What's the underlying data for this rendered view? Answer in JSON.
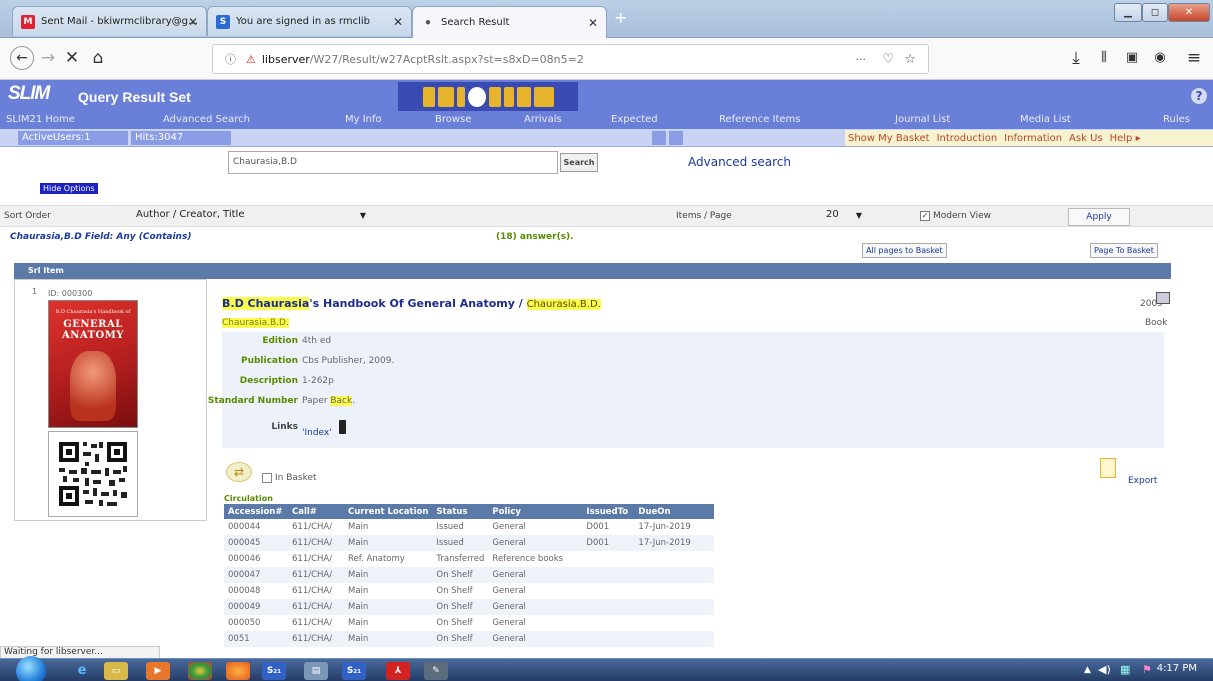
{
  "browser": {
    "tabs": [
      {
        "icon": "gmail-icon",
        "label": "Sent Mail - bkiwrmclibrary@g…"
      },
      {
        "icon": "slim-icon",
        "label": "You are signed in as rmclib"
      },
      {
        "icon": "page-icon",
        "label": "Search Result"
      }
    ],
    "new_tab_label": "+",
    "url_host": "libserver",
    "url_path": "/W27/Result/w27AcptRslt.aspx?st=s8xD=08n5=2",
    "url_more": "···"
  },
  "app": {
    "logo": "SLIM",
    "title": "Query Result Set",
    "help_label": "?",
    "menu": [
      "SLIM21 Home",
      "Advanced Search",
      "My Info",
      "Browse",
      "Arrivals",
      "Expected",
      "Reference Items",
      "Journal List",
      "Media List",
      "Rules"
    ],
    "active_users": "ActiveUsers:1",
    "hits": "Hits:3047",
    "right_links": [
      "Show My Basket",
      "Introduction",
      "Information",
      "Ask Us",
      "Help ▸"
    ]
  },
  "search": {
    "query": "Chaurasia,B.D",
    "button": "Search",
    "advanced_link": "Advanced search",
    "hide_options": "Hide Options"
  },
  "sort": {
    "label": "Sort Order",
    "value": "Author / Creator, Title",
    "items_label": "Items / Page",
    "items_value": "20",
    "modern_view": "Modern View",
    "modern_view_checked": true,
    "apply": "Apply"
  },
  "results": {
    "query_text": "Chaurasia,B.D Field: Any (Contains)",
    "answers": "(18) answer(s).",
    "all_pages_basket": "All pages to Basket",
    "page_to_basket": "Page To Basket",
    "header": "Srl Item"
  },
  "record": {
    "serial": "1",
    "id": "ID: 000300",
    "cover_small": "B.D Chaurasia's Handbook of",
    "cover_big": "GENERAL ANATOMY",
    "title_hl": "B.D Chaurasia",
    "title_rest": "'s Handbook Of General Anatomy / ",
    "title_author": "Chaurasia.B.D.",
    "author": "Chaurasia.B.D.",
    "year": "2009",
    "type": "Book",
    "details": {
      "edition_label": "Edition",
      "edition": "4th ed",
      "publication_label": "Publication",
      "publication": "Cbs Publisher, 2009.",
      "description_label": "Description",
      "description": "1-262p",
      "standard_label": "Standard Number",
      "standard_prefix": "Paper ",
      "standard_hl": "Back",
      "standard_suffix": ".",
      "links_label": "Links",
      "links_value": "'Index'"
    },
    "in_basket": "In Basket",
    "export": "Export",
    "circulation_label": "Circulation",
    "circ_headers": [
      "Accession#",
      "Call#",
      "Current Location",
      "Status",
      "Policy",
      "IssuedTo",
      "DueOn"
    ],
    "circ_rows": [
      [
        "000044",
        "611/CHA/",
        "Main",
        "Issued",
        "General",
        "D001",
        "17-Jun-2019"
      ],
      [
        "000045",
        "611/CHA/",
        "Main",
        "Issued",
        "General",
        "D001",
        "17-Jun-2019"
      ],
      [
        "000046",
        "611/CHA/",
        "Ref. Anatomy",
        "Transferred",
        "Reference books",
        "",
        ""
      ],
      [
        "000047",
        "611/CHA/",
        "Main",
        "On Shelf",
        "General",
        "",
        ""
      ],
      [
        "000048",
        "611/CHA/",
        "Main",
        "On Shelf",
        "General",
        "",
        ""
      ],
      [
        "000049",
        "611/CHA/",
        "Main",
        "On Shelf",
        "General",
        "",
        ""
      ],
      [
        "000050",
        "611/CHA/",
        "Main",
        "On Shelf",
        "General",
        "",
        ""
      ],
      [
        "0051",
        "611/CHA/",
        "Main",
        "On Shelf",
        "General",
        "",
        ""
      ]
    ]
  },
  "statusbar": "Waiting for libserver...",
  "taskbar": {
    "clock": "4:17 PM",
    "slim_a": "S₂₁",
    "slim_b": "S₂₁"
  },
  "colors": {
    "header": "#6a7fd8",
    "highlight": "#fbfb4c",
    "grid_header": "#5b7aa7"
  }
}
